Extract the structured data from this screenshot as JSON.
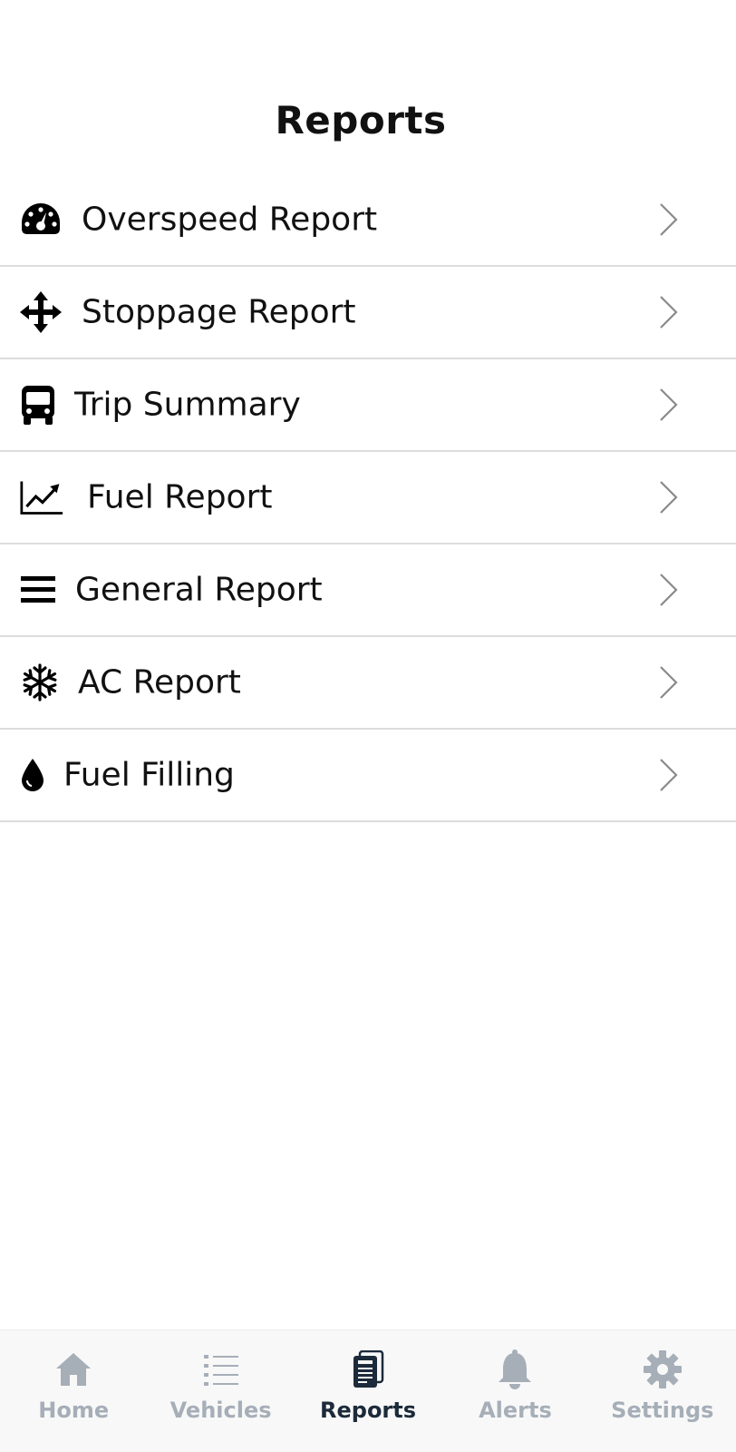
{
  "header": {
    "title": "Reports"
  },
  "reports": [
    {
      "label": "Overspeed Report",
      "icon": "speedometer-icon"
    },
    {
      "label": "Stoppage Report",
      "icon": "move-arrows-icon"
    },
    {
      "label": "Trip Summary",
      "icon": "bus-icon"
    },
    {
      "label": "Fuel Report",
      "icon": "line-chart-icon"
    },
    {
      "label": "General Report",
      "icon": "menu-lines-icon"
    },
    {
      "label": "AC Report",
      "icon": "snowflake-icon"
    },
    {
      "label": "Fuel Filling",
      "icon": "drop-icon"
    }
  ],
  "tabbar": {
    "active_tab": "Reports",
    "active_color": "#1c2a3a",
    "inactive_color": "#a6aeb8",
    "tabs": [
      {
        "label": "Home",
        "icon": "home-icon"
      },
      {
        "label": "Vehicles",
        "icon": "list-icon"
      },
      {
        "label": "Reports",
        "icon": "reports-icon"
      },
      {
        "label": "Alerts",
        "icon": "bell-icon"
      },
      {
        "label": "Settings",
        "icon": "gear-icon"
      }
    ]
  }
}
